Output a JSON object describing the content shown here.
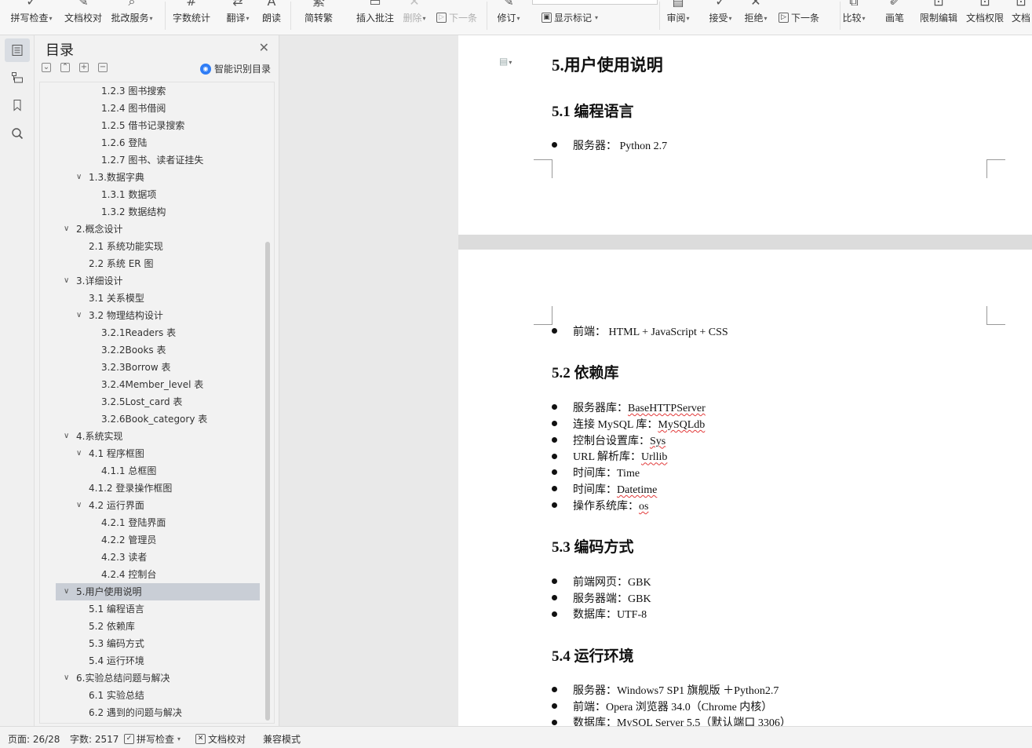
{
  "ribbon": {
    "buttons": [
      {
        "label": "拼写检查",
        "caret": true,
        "icon": "spell-check-icon",
        "glyph": "✓",
        "enabled": true
      },
      {
        "label": "文档校对",
        "caret": false,
        "icon": "proofread-icon",
        "glyph": "✎",
        "enabled": true
      },
      {
        "label": "批改服务",
        "caret": true,
        "icon": "review-service-icon",
        "glyph": "⌕",
        "enabled": true
      },
      {
        "label": "字数统计",
        "caret": false,
        "icon": "word-count-icon",
        "glyph": "#",
        "enabled": true
      },
      {
        "label": "翻译",
        "caret": true,
        "icon": "translate-icon",
        "glyph": "⇄",
        "enabled": true
      },
      {
        "label": "朗读",
        "caret": false,
        "icon": "read-aloud-icon",
        "glyph": "A",
        "enabled": true
      },
      {
        "label": "简转繁",
        "caret": false,
        "icon": "simp-to-trad-icon",
        "glyph": "繁",
        "enabled": true
      },
      {
        "label": "插入批注",
        "caret": false,
        "icon": "insert-comment-icon",
        "glyph": "▭",
        "enabled": true
      },
      {
        "label": "删除",
        "caret": true,
        "icon": "delete-comment-icon",
        "glyph": "✕",
        "enabled": false
      },
      {
        "label": "下一条",
        "caret": false,
        "icon": "next-comment-icon",
        "glyph": "▷",
        "enabled": false
      },
      {
        "label": "修订",
        "caret": true,
        "icon": "track-changes-icon",
        "glyph": "✎",
        "enabled": true
      },
      {
        "label": "显示标记",
        "caret": true,
        "icon": "show-markup-icon",
        "glyph": "▣",
        "enabled": true
      },
      {
        "label": "审阅",
        "caret": true,
        "icon": "review-pane-icon",
        "glyph": "▤",
        "enabled": true
      },
      {
        "label": "接受",
        "caret": true,
        "icon": "accept-icon",
        "glyph": "✓",
        "enabled": true
      },
      {
        "label": "拒绝",
        "caret": true,
        "icon": "reject-icon",
        "glyph": "✕",
        "enabled": true
      },
      {
        "label": "下一条",
        "caret": false,
        "icon": "next-change-icon",
        "glyph": "▷",
        "enabled": true
      },
      {
        "label": "比较",
        "caret": true,
        "icon": "compare-icon",
        "glyph": "⧉",
        "enabled": true
      },
      {
        "label": "画笔",
        "caret": false,
        "icon": "pen-icon",
        "glyph": "✐",
        "enabled": true
      },
      {
        "label": "限制编辑",
        "caret": false,
        "icon": "restrict-editing-icon",
        "glyph": "⊡",
        "enabled": true
      },
      {
        "label": "文档权限",
        "caret": false,
        "icon": "doc-permission-icon",
        "glyph": "⊡",
        "enabled": true
      },
      {
        "label": "文档",
        "caret": false,
        "icon": "doc-icon",
        "glyph": "⊡",
        "enabled": true
      }
    ]
  },
  "nav": {
    "title": "目录",
    "smart_toc": "智能识别目录",
    "items": [
      {
        "label": "1.2.3 图书搜索",
        "level": 3,
        "chevron": false,
        "selected": false
      },
      {
        "label": "1.2.4 图书借阅",
        "level": 3,
        "chevron": false,
        "selected": false
      },
      {
        "label": "1.2.5 借书记录搜索",
        "level": 3,
        "chevron": false,
        "selected": false
      },
      {
        "label": "1.2.6 登陆",
        "level": 3,
        "chevron": false,
        "selected": false
      },
      {
        "label": "1.2.7 图书、读者证挂失",
        "level": 3,
        "chevron": false,
        "selected": false
      },
      {
        "label": "1.3.数据字典",
        "level": 2,
        "chevron": true,
        "selected": false
      },
      {
        "label": "1.3.1 数据项",
        "level": 3,
        "chevron": false,
        "selected": false
      },
      {
        "label": "1.3.2 数据结构",
        "level": 3,
        "chevron": false,
        "selected": false
      },
      {
        "label": "2.概念设计",
        "level": 1,
        "chevron": true,
        "selected": false
      },
      {
        "label": "2.1 系统功能实现",
        "level": 2,
        "chevron": false,
        "selected": false
      },
      {
        "label": "2.2 系统 ER 图",
        "level": 2,
        "chevron": false,
        "selected": false
      },
      {
        "label": "3.详细设计",
        "level": 1,
        "chevron": true,
        "selected": false
      },
      {
        "label": "3.1 关系模型",
        "level": 2,
        "chevron": false,
        "selected": false
      },
      {
        "label": "3.2 物理结构设计",
        "level": 2,
        "chevron": true,
        "selected": false
      },
      {
        "label": "3.2.1Readers 表",
        "level": 3,
        "chevron": false,
        "selected": false
      },
      {
        "label": "3.2.2Books 表",
        "level": 3,
        "chevron": false,
        "selected": false
      },
      {
        "label": "3.2.3Borrow 表",
        "level": 3,
        "chevron": false,
        "selected": false
      },
      {
        "label": "3.2.4Member_level 表",
        "level": 3,
        "chevron": false,
        "selected": false
      },
      {
        "label": "3.2.5Lost_card 表",
        "level": 3,
        "chevron": false,
        "selected": false
      },
      {
        "label": "3.2.6Book_category 表",
        "level": 3,
        "chevron": false,
        "selected": false
      },
      {
        "label": "4.系统实现",
        "level": 1,
        "chevron": true,
        "selected": false
      },
      {
        "label": "4.1 程序框图",
        "level": 2,
        "chevron": true,
        "selected": false
      },
      {
        "label": "4.1.1 总框图",
        "level": 3,
        "chevron": false,
        "selected": false
      },
      {
        "label": "4.1.2 登录操作框图",
        "level": 2,
        "chevron": false,
        "selected": false
      },
      {
        "label": "4.2 运行界面",
        "level": 2,
        "chevron": true,
        "selected": false
      },
      {
        "label": "4.2.1 登陆界面",
        "level": 3,
        "chevron": false,
        "selected": false
      },
      {
        "label": "4.2.2 管理员",
        "level": 3,
        "chevron": false,
        "selected": false
      },
      {
        "label": "4.2.3 读者",
        "level": 3,
        "chevron": false,
        "selected": false
      },
      {
        "label": "4.2.4 控制台",
        "level": 3,
        "chevron": false,
        "selected": false
      },
      {
        "label": "5.用户使用说明",
        "level": 1,
        "chevron": true,
        "selected": true
      },
      {
        "label": "5.1 编程语言",
        "level": 2,
        "chevron": false,
        "selected": false
      },
      {
        "label": "5.2 依赖库",
        "level": 2,
        "chevron": false,
        "selected": false
      },
      {
        "label": "5.3 编码方式",
        "level": 2,
        "chevron": false,
        "selected": false
      },
      {
        "label": "5.4 运行环境",
        "level": 2,
        "chevron": false,
        "selected": false
      },
      {
        "label": "6.实验总结问题与解决",
        "level": 1,
        "chevron": true,
        "selected": false
      },
      {
        "label": "6.1 实验总结",
        "level": 2,
        "chevron": false,
        "selected": false
      },
      {
        "label": "6.2 遇到的问题与解决",
        "level": 2,
        "chevron": false,
        "selected": false
      }
    ]
  },
  "doc": {
    "page1": {
      "h_main": "5.用户使用说明",
      "h_lang": "5.1 编程语言",
      "server_lang": "服务器：  Python 2.7"
    },
    "page2": {
      "frontend": "前端：  HTML + JavaScript + CSS",
      "h_deps": "5.2 依赖库",
      "deps": [
        {
          "prefix": "服务器库：",
          "value": "BaseHTTPServer",
          "squiggle": true
        },
        {
          "prefix": "连接 MySQL 库：",
          "value": "MySQLdb",
          "squiggle": true
        },
        {
          "prefix": "控制台设置库：",
          "value": "Sys",
          "squiggle": true
        },
        {
          "prefix": "URL 解析库：",
          "value": "Urllib",
          "squiggle": true
        },
        {
          "prefix": "时间库：",
          "value": "Time",
          "squiggle": false
        },
        {
          "prefix": "时间库：",
          "value": "Datetime",
          "squiggle": true
        },
        {
          "prefix": "操作系统库：",
          "value": "os",
          "squiggle": true
        }
      ],
      "h_enc": "5.3 编码方式",
      "enc": [
        "前端网页：GBK",
        "服务器端：GBK",
        "数据库：UTF-8"
      ],
      "h_env": "5.4 运行环境",
      "env": [
        "服务器：Windows7 SP1 旗舰版 ＋Python2.7",
        "前端：Opera 浏览器  34.0（Chrome 内核）",
        "数据库：MySQL Server 5.5（默认端口 3306）"
      ]
    }
  },
  "status": {
    "page": "页面: 26/28",
    "words": "字数: 2517",
    "spell": "拼写检查",
    "proof": "文档校对",
    "compat": "兼容模式"
  }
}
